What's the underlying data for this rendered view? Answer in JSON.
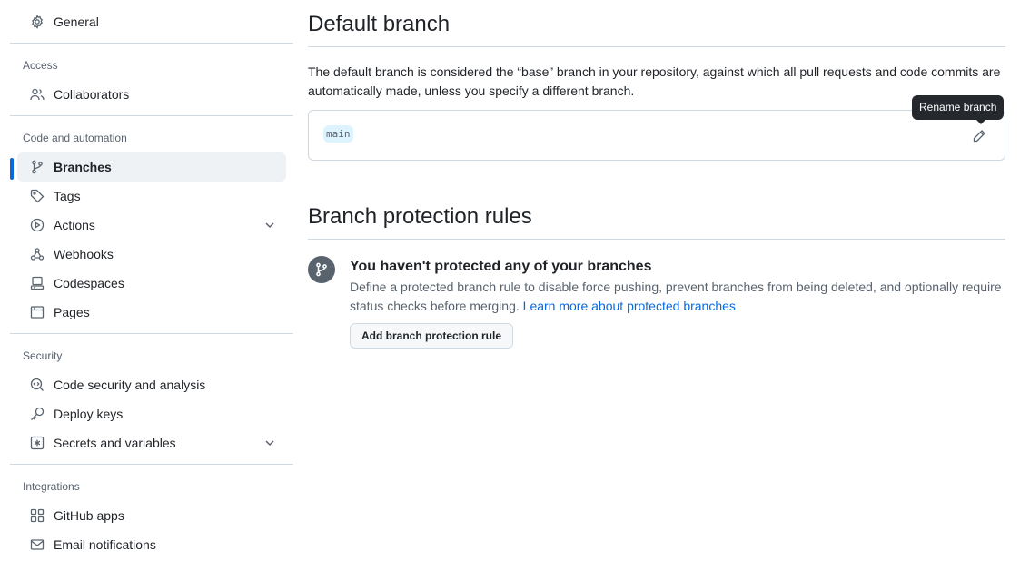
{
  "sidebar": {
    "general": "General",
    "groups": {
      "access": "Access",
      "code": "Code and automation",
      "security": "Security",
      "integrations": "Integrations"
    },
    "items": {
      "collaborators": "Collaborators",
      "branches": "Branches",
      "tags": "Tags",
      "actions": "Actions",
      "webhooks": "Webhooks",
      "codespaces": "Codespaces",
      "pages": "Pages",
      "code_security": "Code security and analysis",
      "deploy_keys": "Deploy keys",
      "secrets": "Secrets and variables",
      "github_apps": "GitHub apps",
      "email_notifications": "Email notifications"
    }
  },
  "default_branch": {
    "title": "Default branch",
    "description": "The default branch is considered the “base” branch in your repository, against which all pull requests and code commits are automatically made, unless you specify a different branch.",
    "branch_name": "main",
    "rename_tooltip": "Rename branch"
  },
  "protection": {
    "title": "Branch protection rules",
    "blank_title": "You haven't protected any of your branches",
    "blank_text": "Define a protected branch rule to disable force pushing, prevent branches from being deleted, and optionally require status checks before merging.",
    "learn_more": "Learn more about protected branches",
    "add_button": "Add branch protection rule"
  },
  "colors": {
    "accent": "#0969da",
    "active_bg": "#eff2f5",
    "border": "#d1d9e0",
    "muted": "#59636e"
  }
}
